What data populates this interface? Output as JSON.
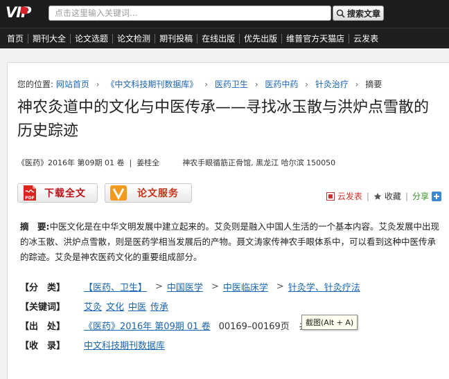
{
  "header": {
    "logo_text": "VIP",
    "search_placeholder": "点击这里输入关键词...",
    "search_button": "搜索文章"
  },
  "nav": {
    "items": [
      "首页",
      "期刊大全",
      "论文选题",
      "论文检测",
      "期刊投稿",
      "在线出版",
      "优先出版",
      "维普官方天猫店",
      "云发表"
    ]
  },
  "breadcrumb": {
    "label": "您的位置:",
    "items": [
      "网站首页",
      "《中文科技期刊数据库》",
      "医药卫生",
      "医药中药",
      "针灸治疗"
    ],
    "current": "摘要"
  },
  "article": {
    "title": "神农灸道中的文化与中医传承——寻找冰玉散与洪炉点雪散的历史踪迹",
    "journal": "《医药》",
    "year_issue": "2016年 第09期 01 卷",
    "author": "姜桂全",
    "affiliation": "神农手眼循筋正骨馆, 黑龙江 哈尔滨 150050",
    "abstract_label": "摘　要:",
    "abstract_text": "中医文化是在中华文明发展中建立起来的。艾灸则是融入中国人生活的一个基本内容。艾灸发展中出现的冰玉散、洪炉点雪散，则是医药学相当发展后的产物。聂文涛家传神农手眼体系中，可以看到这种中医传承的踪迹。艾灸是神农医药文化的重要组成部分。"
  },
  "actions": {
    "download": "下载全文",
    "service": "论文服务",
    "cloud_publish": "云发表",
    "favorite": "收藏",
    "share": "分享"
  },
  "info": {
    "category_label": "【分　类】",
    "categories": [
      "【医药、卫生】",
      "中国医学",
      "中医临床学",
      "针灸学、针灸疗法"
    ],
    "keywords_label": "【关键词】",
    "keywords": [
      "艾灸",
      "文化",
      "中医",
      "传承"
    ],
    "source_label": "【出　处】",
    "source_link": "《医药》2016年 第09期 01 卷",
    "source_pages": "00169–00169页",
    "source_total": "共1页",
    "collection_label": "【收　录】",
    "collection": "中文科技期刊数据库"
  },
  "tooltip": "截图(Alt + A)",
  "colors": {
    "header_bg": "#1c1c1c",
    "link": "#1b66b1",
    "accent_red": "#b8141a"
  }
}
